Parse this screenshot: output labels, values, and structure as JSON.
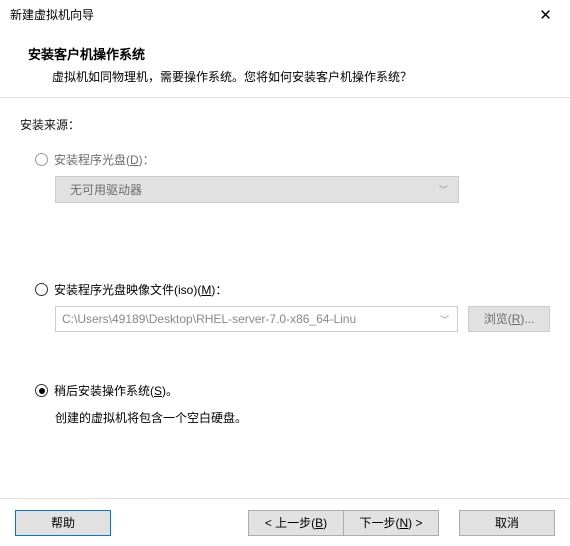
{
  "titlebar": {
    "title": "新建虚拟机向导"
  },
  "header": {
    "title": "安装客户机操作系统",
    "subtitle": "虚拟机如同物理机，需要操作系统。您将如何安装客户机操作系统？"
  },
  "content": {
    "source_label": "安装来源：",
    "option_disc": {
      "label_pre": "安装程序光盘(",
      "accel": "D",
      "label_post": ")：",
      "dropdown_text": "无可用驱动器"
    },
    "option_iso": {
      "label_pre": "安装程序光盘映像文件(iso)(",
      "accel": "M",
      "label_post": ")：",
      "path": "C:\\Users\\49189\\Desktop\\RHEL-server-7.0-x86_64-Linu",
      "browse_pre": "浏览(",
      "browse_accel": "R",
      "browse_post": ")..."
    },
    "option_later": {
      "label_pre": "稍后安装操作系统(",
      "accel": "S",
      "label_post": ")。",
      "description": "创建的虚拟机将包含一个空白硬盘。"
    }
  },
  "buttons": {
    "help": "帮助",
    "back_pre": "< 上一步(",
    "back_accel": "B",
    "back_post": ")",
    "next_pre": "下一步(",
    "next_accel": "N",
    "next_post": ") >",
    "cancel": "取消"
  }
}
